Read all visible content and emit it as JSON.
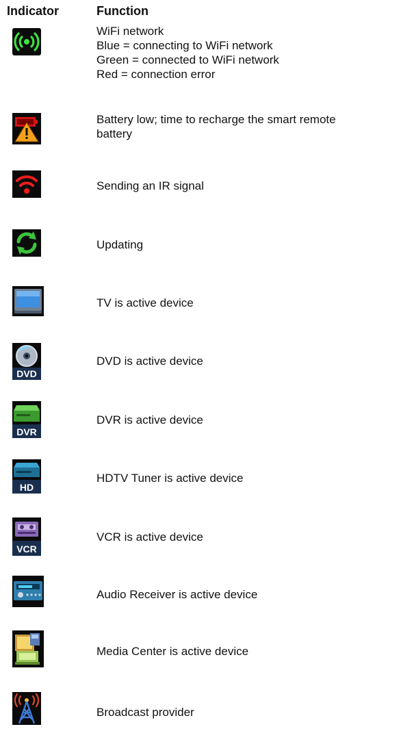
{
  "header": {
    "indicator": "Indicator",
    "function": "Function"
  },
  "rows": [
    {
      "icon": "wifi-icon",
      "lines": [
        "WiFi network",
        "Blue = connecting to WiFi network",
        "Green = connected to WiFi network",
        "Red = connection error"
      ]
    },
    {
      "icon": "battery-low-icon",
      "lines": [
        "Battery low; time to recharge the smart remote",
        "battery"
      ]
    },
    {
      "icon": "ir-signal-icon",
      "lines": [
        "Sending an IR signal"
      ]
    },
    {
      "icon": "updating-icon",
      "lines": [
        "Updating"
      ]
    },
    {
      "icon": "tv-icon",
      "lines": [
        "TV is active device"
      ]
    },
    {
      "icon": "dvd-icon",
      "lines": [
        "DVD is active device"
      ],
      "badge": "DVD"
    },
    {
      "icon": "dvr-icon",
      "lines": [
        "DVR is active device"
      ],
      "badge": "DVR"
    },
    {
      "icon": "hd-tuner-icon",
      "lines": [
        "HDTV Tuner is active device"
      ],
      "badge": "HD"
    },
    {
      "icon": "vcr-icon",
      "lines": [
        "VCR is active device"
      ],
      "badge": "VCR"
    },
    {
      "icon": "audio-receiver-icon",
      "lines": [
        "Audio Receiver is active device"
      ]
    },
    {
      "icon": "media-center-icon",
      "lines": [
        "Media Center is active device"
      ]
    },
    {
      "icon": "broadcast-tower-icon",
      "lines": [
        "Broadcast provider"
      ]
    }
  ]
}
